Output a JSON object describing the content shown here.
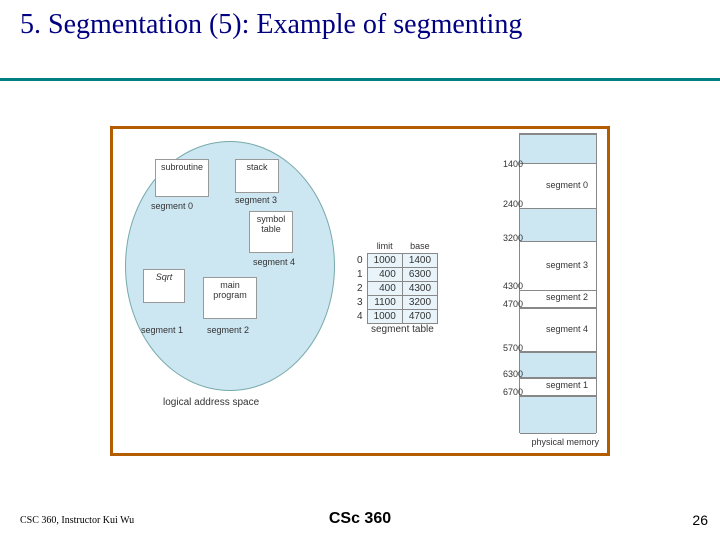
{
  "title": "5. Segmentation (5): Example of segmenting",
  "footer": {
    "left": "CSC 360, Instructor Kui Wu",
    "center": "CSc 360",
    "right": "26"
  },
  "logical_address_space": {
    "label": "logical address space",
    "segments": {
      "subroutine": {
        "box_label": "subroutine",
        "seg_label": "segment 0"
      },
      "sqrt": {
        "box_label": "Sqrt",
        "seg_label": "segment 1"
      },
      "main_program": {
        "box_label": "main\nprogram",
        "seg_label": "segment 2"
      },
      "stack": {
        "box_label": "stack",
        "seg_label": "segment 3"
      },
      "symbol_table": {
        "box_label": "symbol\ntable",
        "seg_label": "segment 4"
      }
    }
  },
  "segment_table": {
    "label": "segment table",
    "headers": {
      "limit": "limit",
      "base": "base"
    },
    "rows": [
      {
        "idx": "0",
        "limit": "1000",
        "base": "1400"
      },
      {
        "idx": "1",
        "limit": "400",
        "base": "6300"
      },
      {
        "idx": "2",
        "limit": "400",
        "base": "4300"
      },
      {
        "idx": "3",
        "limit": "1100",
        "base": "3200"
      },
      {
        "idx": "4",
        "limit": "1000",
        "base": "4700"
      }
    ]
  },
  "physical_memory": {
    "label": "physical memory",
    "addresses": [
      "1400",
      "2400",
      "3200",
      "4300",
      "4700",
      "5700",
      "6300",
      "6700"
    ],
    "segments": [
      {
        "label": "segment 0",
        "start": "1400",
        "end": "2400"
      },
      {
        "label": "segment 3",
        "start": "3200",
        "end": "4300"
      },
      {
        "label": "segment 2",
        "start": "4300",
        "end": "4700"
      },
      {
        "label": "segment 4",
        "start": "4700",
        "end": "5700"
      },
      {
        "label": "segment 1",
        "start": "6300",
        "end": "6700"
      }
    ]
  }
}
